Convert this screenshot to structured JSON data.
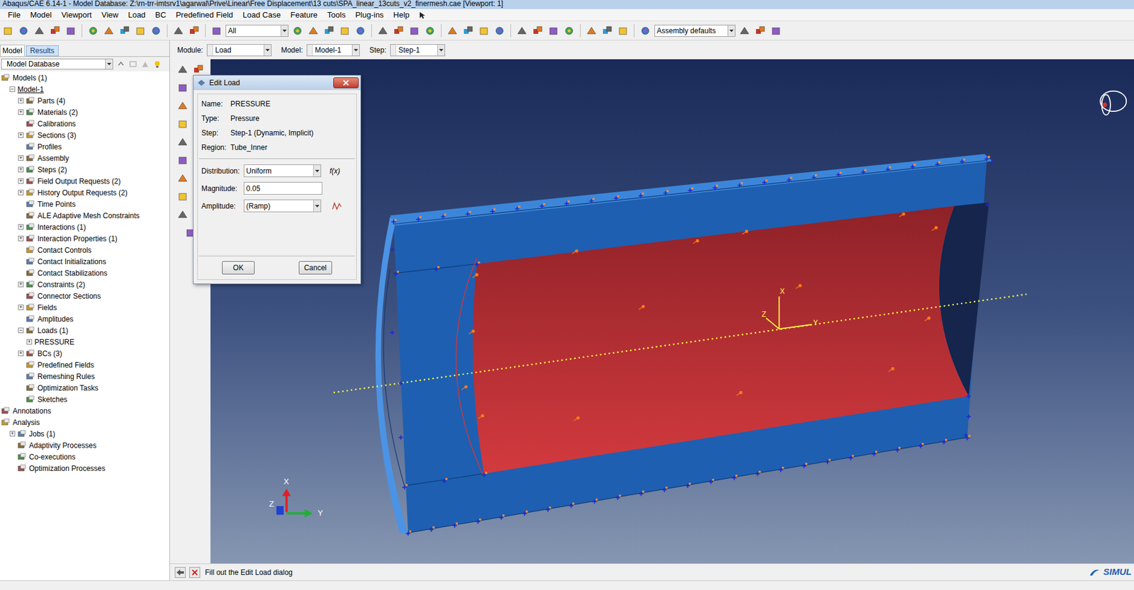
{
  "window": {
    "title": "Abaqus/CAE 6.14-1 - Model Database: Z:\\rn-trr-imtsrv1\\agarwal\\Prive\\Linear\\Free Displacement\\13 cuts\\SPA_linear_13cuts_v2_finermesh.cae [Viewport: 1]"
  },
  "menu": [
    "File",
    "Model",
    "Viewport",
    "View",
    "Load",
    "BC",
    "Predefined Field",
    "Load Case",
    "Feature",
    "Tools",
    "Plug-ins",
    "Help"
  ],
  "toolbar": {
    "selection_filter": "All",
    "render_style": "Assembly defaults"
  },
  "tabs": [
    {
      "label": "Model",
      "selected": true
    },
    {
      "label": "Results",
      "selected": false
    }
  ],
  "context_bar": {
    "module_label": "Module:",
    "module": "Load",
    "model_label": "Model:",
    "model": "Model-1",
    "step_label": "Step:",
    "step": "Step-1"
  },
  "tree": {
    "source": "Model Database",
    "items": [
      {
        "label": "Models (1)",
        "depth": 0,
        "toggle": "",
        "has_icon": true,
        "current": false
      },
      {
        "label": "Model-1",
        "depth": 1,
        "toggle": "−",
        "has_icon": false,
        "current": true
      },
      {
        "label": "Parts (4)",
        "depth": 2,
        "toggle": "+",
        "has_icon": true,
        "current": false
      },
      {
        "label": "Materials (2)",
        "depth": 2,
        "toggle": "+",
        "has_icon": true,
        "current": false
      },
      {
        "label": "Calibrations",
        "depth": 2,
        "toggle": "",
        "has_icon": true,
        "current": false
      },
      {
        "label": "Sections (3)",
        "depth": 2,
        "toggle": "+",
        "has_icon": true,
        "current": false
      },
      {
        "label": "Profiles",
        "depth": 2,
        "toggle": "",
        "has_icon": true,
        "current": false
      },
      {
        "label": "Assembly",
        "depth": 2,
        "toggle": "+",
        "has_icon": true,
        "current": false
      },
      {
        "label": "Steps (2)",
        "depth": 2,
        "toggle": "+",
        "has_icon": true,
        "current": false
      },
      {
        "label": "Field Output Requests (2)",
        "depth": 2,
        "toggle": "+",
        "has_icon": true,
        "current": false
      },
      {
        "label": "History Output Requests (2)",
        "depth": 2,
        "toggle": "+",
        "has_icon": true,
        "current": false
      },
      {
        "label": "Time Points",
        "depth": 2,
        "toggle": "",
        "has_icon": true,
        "current": false
      },
      {
        "label": "ALE Adaptive Mesh Constraints",
        "depth": 2,
        "toggle": "",
        "has_icon": true,
        "current": false
      },
      {
        "label": "Interactions (1)",
        "depth": 2,
        "toggle": "+",
        "has_icon": true,
        "current": false
      },
      {
        "label": "Interaction Properties (1)",
        "depth": 2,
        "toggle": "+",
        "has_icon": true,
        "current": false
      },
      {
        "label": "Contact Controls",
        "depth": 2,
        "toggle": "",
        "has_icon": true,
        "current": false
      },
      {
        "label": "Contact Initializations",
        "depth": 2,
        "toggle": "",
        "has_icon": true,
        "current": false
      },
      {
        "label": "Contact Stabilizations",
        "depth": 2,
        "toggle": "",
        "has_icon": true,
        "current": false
      },
      {
        "label": "Constraints (2)",
        "depth": 2,
        "toggle": "+",
        "has_icon": true,
        "current": false
      },
      {
        "label": "Connector Sections",
        "depth": 2,
        "toggle": "",
        "has_icon": true,
        "current": false
      },
      {
        "label": "Fields",
        "depth": 2,
        "toggle": "+",
        "has_icon": true,
        "current": false
      },
      {
        "label": "Amplitudes",
        "depth": 2,
        "toggle": "",
        "has_icon": true,
        "current": false
      },
      {
        "label": "Loads (1)",
        "depth": 2,
        "toggle": "−",
        "has_icon": true,
        "current": false
      },
      {
        "label": "PRESSURE",
        "depth": 3,
        "toggle": "+",
        "has_icon": false,
        "current": false
      },
      {
        "label": "BCs (3)",
        "depth": 2,
        "toggle": "+",
        "has_icon": true,
        "current": false
      },
      {
        "label": "Predefined Fields",
        "depth": 2,
        "toggle": "",
        "has_icon": true,
        "current": false
      },
      {
        "label": "Remeshing Rules",
        "depth": 2,
        "toggle": "",
        "has_icon": true,
        "current": false
      },
      {
        "label": "Optimization Tasks",
        "depth": 2,
        "toggle": "",
        "has_icon": true,
        "current": false
      },
      {
        "label": "Sketches",
        "depth": 2,
        "toggle": "",
        "has_icon": true,
        "current": false
      },
      {
        "label": "Annotations",
        "depth": 0,
        "toggle": "",
        "has_icon": true,
        "current": false
      },
      {
        "label": "Analysis",
        "depth": 0,
        "toggle": "",
        "has_icon": true,
        "current": false
      },
      {
        "label": "Jobs (1)",
        "depth": 1,
        "toggle": "+",
        "has_icon": true,
        "current": false
      },
      {
        "label": "Adaptivity Processes",
        "depth": 1,
        "toggle": "",
        "has_icon": true,
        "current": false
      },
      {
        "label": "Co-executions",
        "depth": 1,
        "toggle": "",
        "has_icon": true,
        "current": false
      },
      {
        "label": "Optimization Processes",
        "depth": 1,
        "toggle": "",
        "has_icon": true,
        "current": false
      }
    ]
  },
  "dialog": {
    "title": "Edit Load",
    "info": [
      {
        "label": "Name:",
        "value": "PRESSURE"
      },
      {
        "label": "Type:",
        "value": "Pressure"
      },
      {
        "label": "Step:",
        "value": "Step-1 (Dynamic, Implicit)"
      },
      {
        "label": "Region:",
        "value": "Tube_Inner"
      }
    ],
    "distribution": {
      "label": "Distribution:",
      "value": "Uniform",
      "function_button": "f(x)"
    },
    "magnitude": {
      "label": "Magnitude:",
      "value": "0.05"
    },
    "amplitude": {
      "label": "Amplitude:",
      "value": "(Ramp)"
    },
    "buttons": [
      "OK",
      "Cancel"
    ]
  },
  "viewport": {
    "csys_labels": {
      "x": "X",
      "y": "Y",
      "z": "Z"
    },
    "triad_labels": {
      "x": "X",
      "y": "Y",
      "z": "Z"
    }
  },
  "prompt": {
    "text": "Fill out the Edit Load dialog"
  },
  "brand": "SIMUL"
}
